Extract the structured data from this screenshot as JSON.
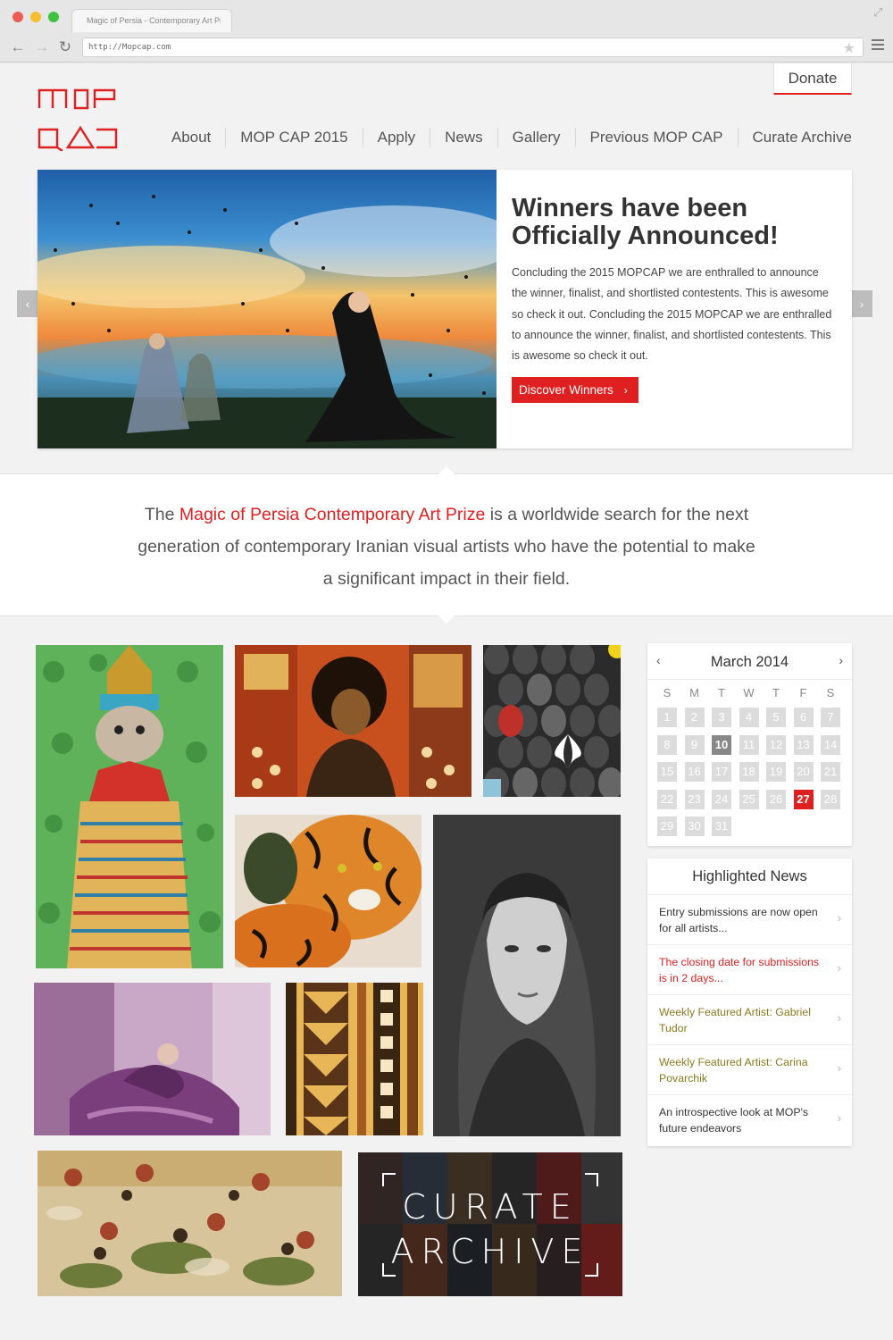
{
  "browser": {
    "tab_title": "Magic of Persia - Contemporary Art Prize",
    "url": "http://Mopcap.com",
    "back_glyph": "←",
    "forward_glyph": "→",
    "reload_glyph": "↻",
    "star_glyph": "★",
    "expand_glyph": "⤢"
  },
  "header": {
    "donate_label": "Donate",
    "nav": [
      "About",
      "MOP CAP 2015",
      "Apply",
      "News",
      "Gallery",
      "Previous MOP CAP",
      "Curate Archive"
    ]
  },
  "hero": {
    "title": "Winners have been Officially Announced!",
    "body": "Concluding the 2015 MOPCAP we are enthralled to announce the winner, finalist, and shortlisted contestents. This is awesome so check it out. Concluding the 2015 MOPCAP we are enthralled to announce the winner, finalist, and shortlisted contestents. This is awesome so check it out.",
    "button_label": "Discover Winners",
    "button_chevron": "›",
    "prev_glyph": "‹",
    "next_glyph": "›"
  },
  "intro": {
    "before": "The ",
    "highlight": "Magic of Persia Contemporary Art Prize",
    "after": " is a worldwide search for the next generation of contemporary Iranian visual artists who have the potential to make a significant impact in their field."
  },
  "gallery": {
    "curate_line1": "CURATE",
    "curate_line2": "ARCHIVE"
  },
  "calendar": {
    "title": "March 2014",
    "prev_glyph": "‹",
    "next_glyph": "›",
    "weekdays": [
      "S",
      "M",
      "T",
      "W",
      "T",
      "F",
      "S"
    ],
    "days": [
      "1",
      "2",
      "3",
      "4",
      "5",
      "6",
      "7",
      "8",
      "9",
      "10",
      "11",
      "12",
      "13",
      "14",
      "15",
      "16",
      "17",
      "18",
      "19",
      "20",
      "21",
      "22",
      "23",
      "24",
      "25",
      "26",
      "27",
      "28",
      "29",
      "30",
      "31"
    ],
    "today": "10",
    "selected": "27"
  },
  "news": {
    "title": "Highlighted News",
    "chevron": "›",
    "items": [
      {
        "text": "Entry submissions are now open for all artists...",
        "color": "#333333"
      },
      {
        "text": "The closing date for submissions is in 2 days...",
        "color": "#e02020"
      },
      {
        "text": "Weekly Featured Artist: Gabriel Tudor",
        "color": "#8a7a1e"
      },
      {
        "text": "Weekly Featured Artist: Carina Povarchik",
        "color": "#8a7a1e"
      },
      {
        "text": "An introspective look at MOP's future endeavors",
        "color": "#333333"
      }
    ]
  },
  "colors": {
    "accent": "#e02020",
    "featured": "#8a7a1e"
  }
}
